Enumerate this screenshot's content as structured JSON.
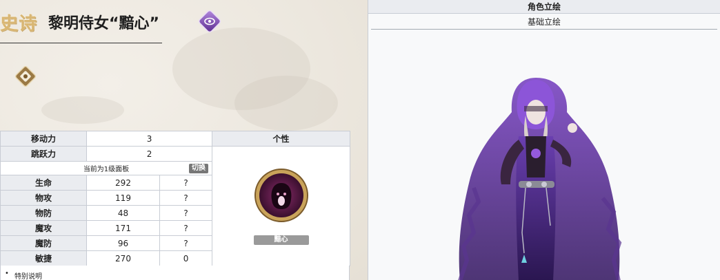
{
  "header": {
    "rarity": "史诗",
    "name": "黎明侍女“黯心”"
  },
  "icons": {
    "class_icon": "purple-diamond-eye-icon",
    "sub_icon": "gold-diamond-emblem-icon",
    "trait_icon": "dark-spirit-trait-icon"
  },
  "stats": {
    "rows_top": [
      {
        "label": "移动力",
        "value": "3"
      },
      {
        "label": "跳跃力",
        "value": "2"
      }
    ],
    "trait_header": "个性",
    "panel_note": "当前为1级面板",
    "switch_label": "切换",
    "rows": [
      {
        "label": "生命",
        "value": "292",
        "extra": "?"
      },
      {
        "label": "物攻",
        "value": "119",
        "extra": "?"
      },
      {
        "label": "物防",
        "value": "48",
        "extra": "?"
      },
      {
        "label": "魔攻",
        "value": "171",
        "extra": "?"
      },
      {
        "label": "魔防",
        "value": "96",
        "extra": "?"
      },
      {
        "label": "敏捷",
        "value": "270",
        "extra": "0"
      }
    ],
    "trait_name": "黯心"
  },
  "notes": {
    "item": "特别说明"
  },
  "right": {
    "title": "角色立绘",
    "tab": "基础立绘"
  },
  "colors": {
    "rarity_gold": "#d9b673",
    "table_header_bg": "#eaecf0",
    "border": "#c8ccd4",
    "accent_purple": "#6b3fa0"
  }
}
